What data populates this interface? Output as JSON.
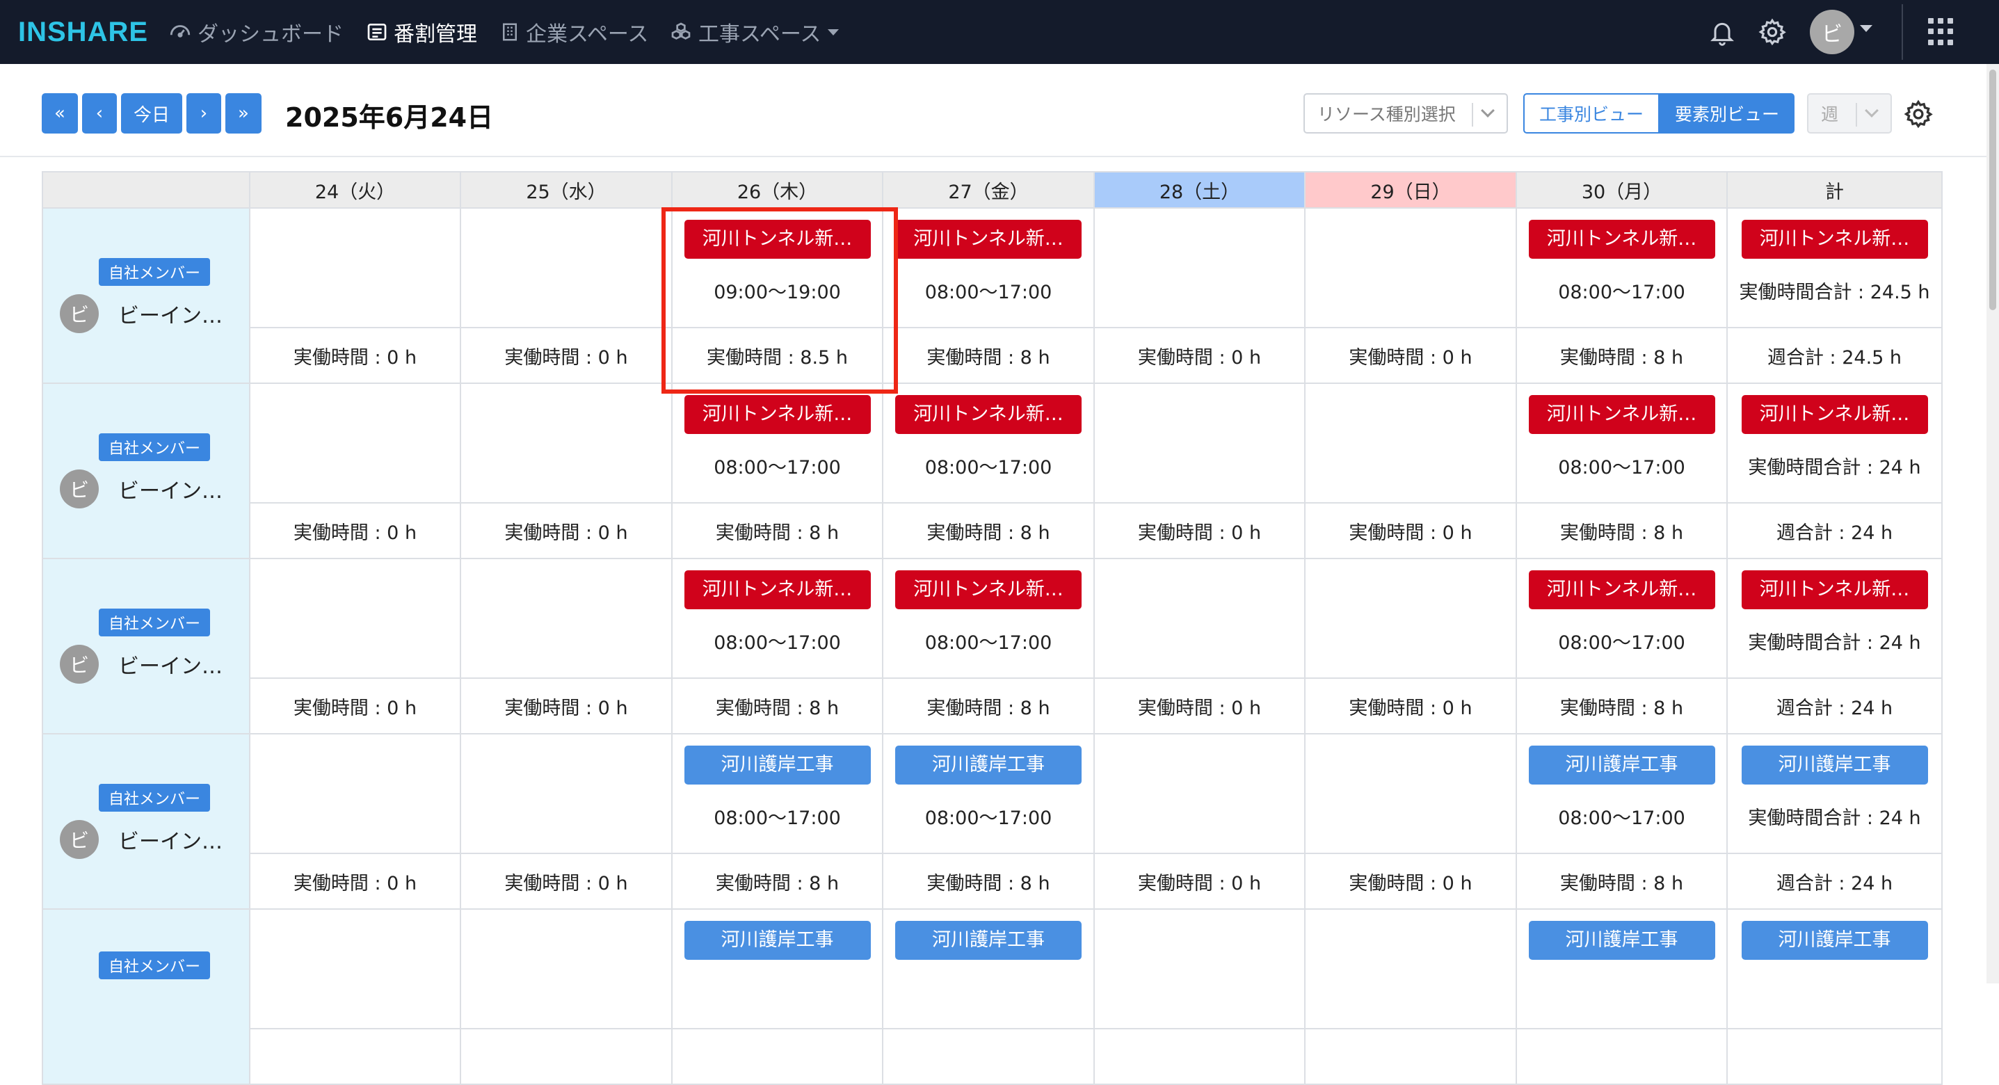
{
  "header": {
    "logo": "INSHARE",
    "nav": [
      {
        "label": "ダッシュボード",
        "icon": "dashboard-icon"
      },
      {
        "label": "番割管理",
        "icon": "list-icon",
        "active": true
      },
      {
        "label": "企業スペース",
        "icon": "building-icon"
      },
      {
        "label": "工事スペース",
        "icon": "cubes-icon"
      }
    ],
    "user_initial": "ビ"
  },
  "toolbar": {
    "first": "«",
    "prev": "‹",
    "today": "今日",
    "next": "›",
    "last": "»",
    "date": "2025年6月24日",
    "resource_placeholder": "リソース種別選択",
    "view_project": "工事別ビュー",
    "view_element": "要素別ビュー",
    "period": "週"
  },
  "colors": {
    "accent": "#3a86e0",
    "red_chip": "#d0021b",
    "blue_chip": "#4a90e2",
    "saturday": "#a9cbfa",
    "sunday": "#ffc9cb",
    "highlight": "#ee2716"
  },
  "table": {
    "columns": [
      "",
      "24（火）",
      "25（水）",
      "26（木）",
      "27（金）",
      "28（土）",
      "29（日）",
      "30（月）",
      "計"
    ],
    "rows": [
      {
        "badge": "自社メンバー",
        "initial": "ビ",
        "name": "ビーイン…",
        "chips": [
          "",
          "",
          "河川トンネル新…",
          "河川トンネル新…",
          "",
          "",
          "河川トンネル新…",
          "河川トンネル新…"
        ],
        "times": [
          "",
          "",
          "09:00〜19:00",
          "08:00〜17:00",
          "",
          "",
          "08:00〜17:00",
          "実働時間合計 : 24.5 h"
        ],
        "hours": [
          "実働時間 : 0 h",
          "実働時間 : 0 h",
          "実働時間 : 8.5 h",
          "実働時間 : 8 h",
          "実働時間 : 0 h",
          "実働時間 : 0 h",
          "実働時間 : 8 h",
          "週合計 : 24.5 h"
        ]
      },
      {
        "badge": "自社メンバー",
        "initial": "ビ",
        "name": "ビーイン…",
        "chips": [
          "",
          "",
          "河川トンネル新…",
          "河川トンネル新…",
          "",
          "",
          "河川トンネル新…",
          "河川トンネル新…"
        ],
        "times": [
          "",
          "",
          "08:00〜17:00",
          "08:00〜17:00",
          "",
          "",
          "08:00〜17:00",
          "実働時間合計 : 24 h"
        ],
        "hours": [
          "実働時間 : 0 h",
          "実働時間 : 0 h",
          "実働時間 : 8 h",
          "実働時間 : 8 h",
          "実働時間 : 0 h",
          "実働時間 : 0 h",
          "実働時間 : 8 h",
          "週合計 : 24 h"
        ]
      },
      {
        "badge": "自社メンバー",
        "initial": "ビ",
        "name": "ビーイン…",
        "chips": [
          "",
          "",
          "河川トンネル新…",
          "河川トンネル新…",
          "",
          "",
          "河川トンネル新…",
          "河川トンネル新…"
        ],
        "times": [
          "",
          "",
          "08:00〜17:00",
          "08:00〜17:00",
          "",
          "",
          "08:00〜17:00",
          "実働時間合計 : 24 h"
        ],
        "hours": [
          "実働時間 : 0 h",
          "実働時間 : 0 h",
          "実働時間 : 8 h",
          "実働時間 : 8 h",
          "実働時間 : 0 h",
          "実働時間 : 0 h",
          "実働時間 : 8 h",
          "週合計 : 24 h"
        ]
      },
      {
        "badge": "自社メンバー",
        "initial": "ビ",
        "name": "ビーイン…",
        "chips": [
          "",
          "",
          "河川護岸工事",
          "河川護岸工事",
          "",
          "",
          "河川護岸工事",
          "河川護岸工事"
        ],
        "times": [
          "",
          "",
          "08:00〜17:00",
          "08:00〜17:00",
          "",
          "",
          "08:00〜17:00",
          "実働時間合計 : 24 h"
        ],
        "hours": [
          "実働時間 : 0 h",
          "実働時間 : 0 h",
          "実働時間 : 8 h",
          "実働時間 : 8 h",
          "実働時間 : 0 h",
          "実働時間 : 0 h",
          "実働時間 : 8 h",
          "週合計 : 24 h"
        ]
      },
      {
        "badge": "自社メンバー",
        "initial": "",
        "name": "",
        "chips": [
          "",
          "",
          "河川護岸工事",
          "河川護岸工事",
          "",
          "",
          "河川護岸工事",
          "河川護岸工事"
        ],
        "times": [
          "",
          "",
          "",
          "",
          "",
          "",
          "",
          ""
        ],
        "hours": [
          "",
          "",
          "",
          "",
          "",
          "",
          "",
          ""
        ]
      }
    ]
  }
}
